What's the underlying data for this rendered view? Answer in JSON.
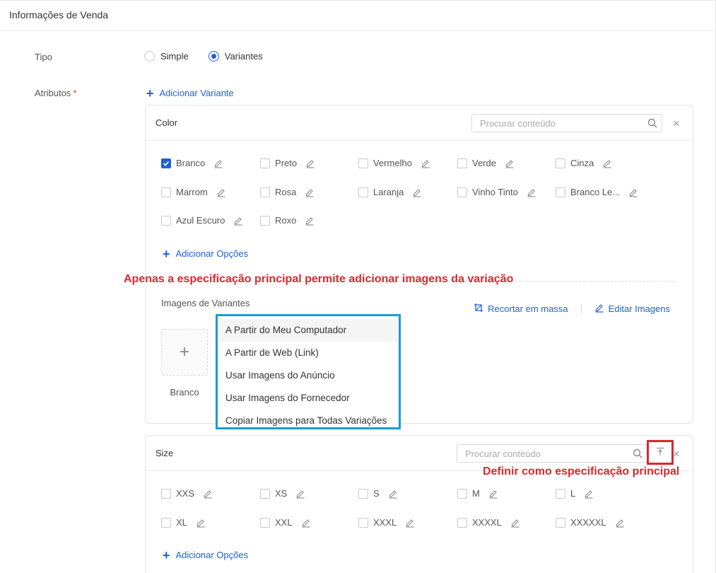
{
  "section_title": "Informações de Venda",
  "tipo": {
    "label": "Tipo",
    "options": [
      {
        "label": "Simple",
        "selected": false
      },
      {
        "label": "Variantes",
        "selected": true
      }
    ]
  },
  "atributos": {
    "label": "Atributos",
    "required_mark": "*",
    "add_variant": "Adicionar Variante"
  },
  "color_card": {
    "title": "Color",
    "search_placeholder": "Procurar conteúdo",
    "close": "×",
    "options": [
      {
        "label": "Branco",
        "checked": true
      },
      {
        "label": "Preto",
        "checked": false
      },
      {
        "label": "Vermelho",
        "checked": false
      },
      {
        "label": "Verde",
        "checked": false
      },
      {
        "label": "Cinza",
        "checked": false
      },
      {
        "label": "Marrom",
        "checked": false
      },
      {
        "label": "Rosa",
        "checked": false
      },
      {
        "label": "Laranja",
        "checked": false
      },
      {
        "label": "Vinho Tinto",
        "checked": false
      },
      {
        "label": "Branco Le...",
        "checked": false
      },
      {
        "label": "Azul Escuro",
        "checked": false
      },
      {
        "label": "Roxo",
        "checked": false
      }
    ],
    "add_options": "Adicionar Opções",
    "images_label": "Imagens de Variantes",
    "crop_bulk": "Recortar em massa",
    "edit_images": "Editar Imagens",
    "upload_caption": "Branco",
    "upload_plus": "+"
  },
  "image_menu": [
    "A Partir do Meu Computador",
    "A Partir de Web (Link)",
    "Usar Imagens do Anúncio",
    "Usar Imagens do Fornecedor",
    "Copiar Imagens para Todas Variações"
  ],
  "size_card": {
    "title": "Size",
    "search_placeholder": "Procurar conteúdo",
    "close": "×",
    "options": [
      {
        "label": "XXS",
        "checked": false
      },
      {
        "label": "XS",
        "checked": false
      },
      {
        "label": "S",
        "checked": false
      },
      {
        "label": "M",
        "checked": false
      },
      {
        "label": "L",
        "checked": false
      },
      {
        "label": "XL",
        "checked": false
      },
      {
        "label": "XXL",
        "checked": false
      },
      {
        "label": "XXXL",
        "checked": false
      },
      {
        "label": "XXXXL",
        "checked": false
      },
      {
        "label": "XXXXXL",
        "checked": false
      }
    ],
    "add_options": "Adicionar Opções"
  },
  "annotations": {
    "main_spec_images": "Apenas a especificação principal permite adicionar imagens da variação",
    "set_main_spec": "Definir como especificação principal"
  },
  "colors": {
    "accent": "#1f5fd8",
    "annotation_red": "#e0262f",
    "dropdown_border": "#1a9bdc"
  }
}
